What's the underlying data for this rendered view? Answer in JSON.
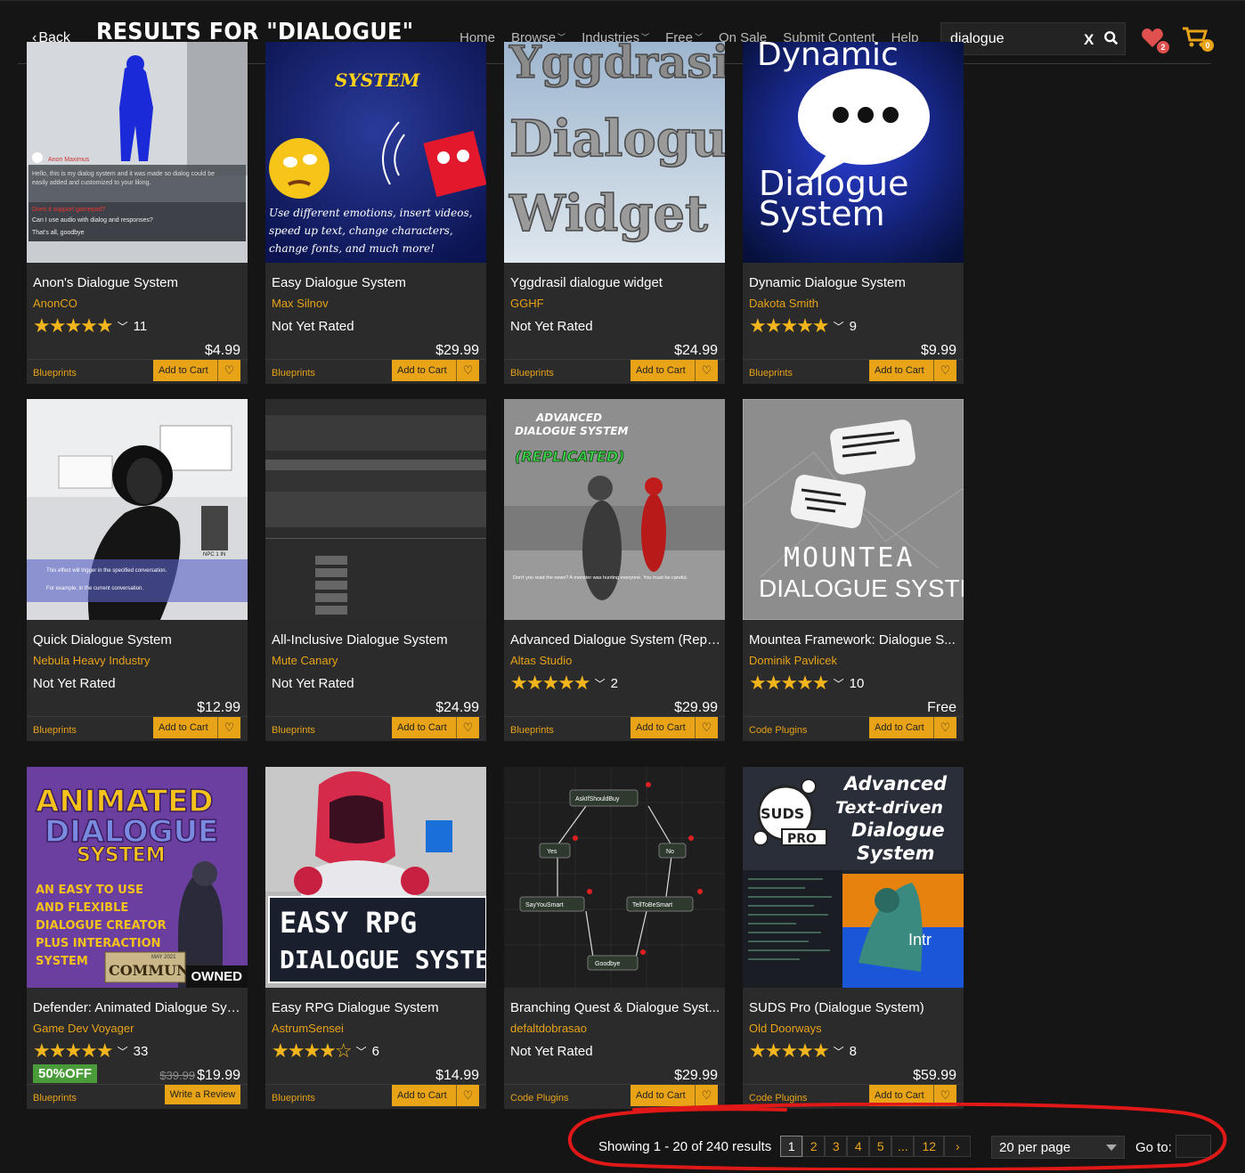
{
  "header": {
    "back_label": "Back",
    "title": "RESULTS FOR \"DIALOGUE\"",
    "nav": [
      {
        "label": "Home",
        "dropdown": false
      },
      {
        "label": "Browse",
        "dropdown": true
      },
      {
        "label": "Industries",
        "dropdown": true
      },
      {
        "label": "Free",
        "dropdown": true
      },
      {
        "label": "On Sale",
        "dropdown": false
      },
      {
        "label": "Submit Content",
        "dropdown": false
      },
      {
        "label": "Help",
        "dropdown": false
      }
    ],
    "search_value": "dialogue",
    "search_clear": "X",
    "wishlist_count": "2",
    "cart_count": "0"
  },
  "colors": {
    "accent": "#e8a317",
    "sale": "#4a9c3a",
    "annotation": "#e01818"
  },
  "products": [
    {
      "title": "Anon's Dialogue System",
      "author": "AnonCO",
      "stars": "★★★★★",
      "reviews": "11",
      "rated": true,
      "price": "$4.99",
      "category": "Blueprints",
      "action": "Add to Cart"
    },
    {
      "title": "Easy Dialogue System",
      "author": "Max Silnov",
      "rating_text": "Not Yet Rated",
      "rated": false,
      "price": "$29.99",
      "category": "Blueprints",
      "action": "Add to Cart"
    },
    {
      "title": "Yggdrasil dialogue widget",
      "author": "GGHF",
      "rating_text": "Not Yet Rated",
      "rated": false,
      "price": "$24.99",
      "category": "Blueprints",
      "action": "Add to Cart"
    },
    {
      "title": "Dynamic Dialogue System",
      "author": "Dakota Smith",
      "stars": "★★★★★",
      "reviews": "9",
      "rated": true,
      "price": "$9.99",
      "category": "Blueprints",
      "action": "Add to Cart"
    },
    {
      "title": "Quick Dialogue System",
      "author": "Nebula Heavy Industry",
      "rating_text": "Not Yet Rated",
      "rated": false,
      "price": "$12.99",
      "category": "Blueprints",
      "action": "Add to Cart"
    },
    {
      "title": "All-Inclusive Dialogue System",
      "author": "Mute Canary",
      "rating_text": "Not Yet Rated",
      "rated": false,
      "price": "$24.99",
      "category": "Blueprints",
      "action": "Add to Cart"
    },
    {
      "title": "Advanced Dialogue System (Repli...",
      "author": "Altas Studio",
      "stars": "★★★★★",
      "reviews": "2",
      "rated": true,
      "price": "$29.99",
      "category": "Blueprints",
      "action": "Add to Cart"
    },
    {
      "title": "Mountea Framework: Dialogue S...",
      "author": "Dominik Pavlicek",
      "stars": "★★★★★",
      "reviews": "10",
      "rated": true,
      "price": "Free",
      "category": "Code Plugins",
      "action": "Add to Cart"
    },
    {
      "title": "Defender: Animated Dialogue Sys...",
      "author": "Game Dev Voyager",
      "stars": "★★★★★",
      "reviews": "33",
      "rated": true,
      "price": "$19.99",
      "old_price": "$39.99",
      "sale": "50%OFF",
      "owned": "OWNED",
      "category": "Blueprints",
      "action": "Write a Review"
    },
    {
      "title": "Easy RPG Dialogue System",
      "author": "AstrumSensei",
      "stars": "★★★★☆",
      "reviews": "6",
      "rated": true,
      "price": "$14.99",
      "category": "Blueprints",
      "action": "Add to Cart"
    },
    {
      "title": "Branching Quest & Dialogue Syst...",
      "author": "defaltdobrasao",
      "rating_text": "Not Yet Rated",
      "rated": false,
      "price": "$29.99",
      "category": "Code Plugins",
      "action": "Add to Cart"
    },
    {
      "title": "SUDS Pro (Dialogue System)",
      "author": "Old Doorways",
      "stars": "★★★★★",
      "reviews": "8",
      "rated": true,
      "price": "$59.99",
      "category": "Code Plugins",
      "action": "Add to Cart"
    }
  ],
  "thumbs": {
    "t1": {
      "caption_name": "Anon Maximus",
      "line1": "Hello, this is my dialog system and it was made so dialog could be",
      "line2": "easily added and customized to your liking.",
      "q1": "Does it support gamepad?",
      "q2": "Can I use audio with dialog and responses?",
      "q3": "That's all, goodbye"
    },
    "t2": {
      "top": "SYSTEM",
      "l1": "Use different emotions, insert videos,",
      "l2": "speed up text, change characters,",
      "l3": "change fonts, and much more!"
    },
    "t3": {
      "l0": "Yggdrasil",
      "l1": "Dialogue",
      "l2": "Widget"
    },
    "t4": {
      "l0": "Dynamic",
      "l1": "Dialogue",
      "l2": "System"
    },
    "t5": {
      "npc": "NPC 1 IN",
      "l1": "This effect will trigger in the specified conversation.",
      "l2": "For example, in the current conversation."
    },
    "t7": {
      "l1": "ADVANCED",
      "l2": "DIALOGUE SYSTEM",
      "l3": "(REPLICATED)",
      "sub": "Don't you read the news? A monster was hunting everyone. You must be careful."
    },
    "t8": {
      "l1": "MOUNTEA",
      "l2": "DIALOGUE SYSTEM"
    },
    "t9": {
      "l1": "ANIMATED",
      "l2": "DIALOGUE",
      "l3": "SYSTEM",
      "d1": "AN EASY TO USE",
      "d2": "AND FLEXIBLE",
      "d3": "DIALOGUE CREATOR",
      "d4": "PLUS INTERACTION",
      "d5": "SYSTEM",
      "comm": "COMMUNITY",
      "date": "MAY 2021"
    },
    "t10": {
      "l1": "EASY RPG",
      "l2": "DIALOGUE SYSTEM"
    },
    "t11": {
      "n1": "AskIfShouldBuy",
      "n2": "Yes",
      "n3": "No",
      "n4": "SayYouSmart",
      "n5": "TellToBeSmart",
      "n6": "Goodbye"
    },
    "t12": {
      "logo": "SUDS",
      "pro": "PRO",
      "l1": "Advanced",
      "l2": "Text-driven",
      "l3": "Dialogue",
      "l4": "System",
      "intro": "Intr"
    }
  },
  "pagination": {
    "info": "Showing 1 - 20 of 240 results",
    "pages": [
      "1",
      "2",
      "3",
      "4",
      "5",
      "...",
      "12"
    ],
    "next": "›",
    "per_page": "20 per page",
    "goto_label": "Go to:"
  }
}
